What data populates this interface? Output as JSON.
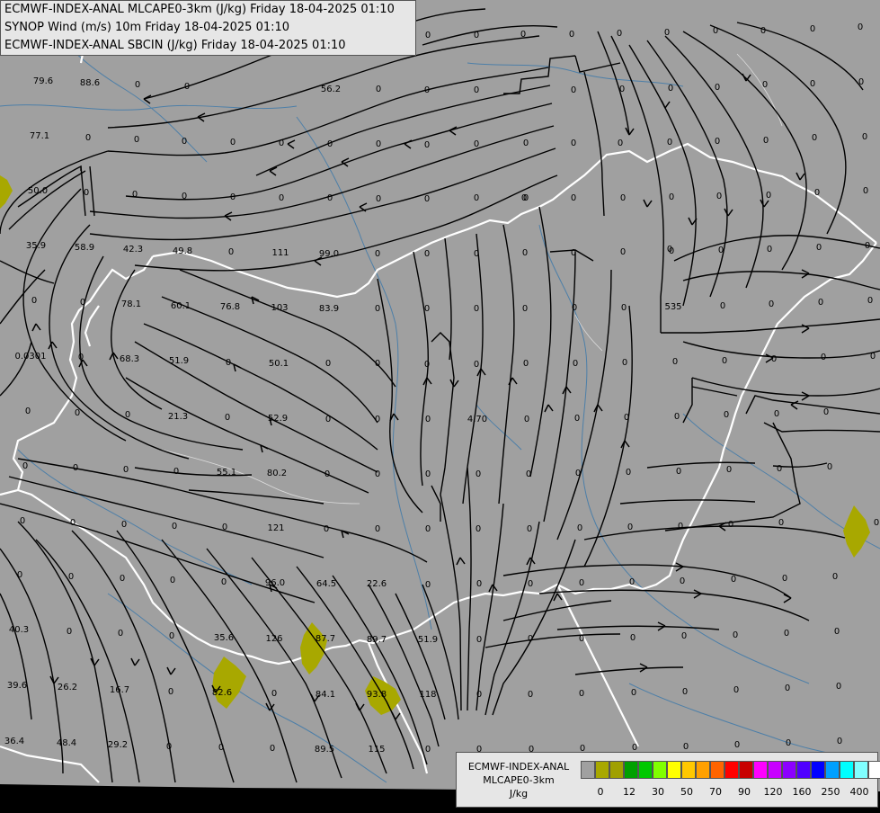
{
  "header": {
    "line1": "ECMWF-INDEX-ANAL MLCAPE0-3km (J/kg) Friday 18-04-2025 01:10",
    "line2": "SYNOP Wind (m/s) 10m Friday 18-04-2025 01:10",
    "line3": "ECMWF-INDEX-ANAL SBCIN (J/kg) Friday 18-04-2025 01:10"
  },
  "legend": {
    "title_line1": "ECMWF-INDEX-ANAL",
    "title_line2": "MLCAPE0-3km",
    "unit": "J/kg",
    "colors": [
      "#a0a0a0",
      "#a8a800",
      "#a0a000",
      "#00a000",
      "#00c800",
      "#80ff00",
      "#ffff00",
      "#ffc800",
      "#ffa000",
      "#ff6400",
      "#ff0000",
      "#c80000",
      "#ff00ff",
      "#c800ff",
      "#8c00ff",
      "#5000ff",
      "#0000ff",
      "#00a0ff",
      "#00ffff",
      "#80ffff",
      "#ffffff"
    ],
    "ticks": [
      "0",
      "12",
      "30",
      "50",
      "70",
      "90",
      "120",
      "160",
      "250",
      "400"
    ]
  },
  "colors": {
    "background": "#a0a0a0",
    "border": "#ffffff",
    "river": "#4d7fa8",
    "streamline": "#000000",
    "cape_fill": "#a8a800",
    "sea": "#000000"
  },
  "sbcin_labels": [
    [
      "x",
      48,
      89,
      "79.6"
    ],
    [
      "x",
      100,
      91,
      "88.6"
    ],
    [
      "x",
      153,
      93,
      "0"
    ],
    [
      "x",
      208,
      95,
      "0"
    ],
    [
      "x",
      368,
      98,
      "56.2"
    ],
    [
      "x",
      421,
      98,
      "0"
    ],
    [
      "x",
      475,
      99,
      "0"
    ],
    [
      "x",
      530,
      99,
      "0"
    ],
    [
      "x",
      44,
      150,
      "77.1"
    ],
    [
      "x",
      98,
      152,
      "0"
    ],
    [
      "x",
      152,
      154,
      "0"
    ],
    [
      "x",
      205,
      156,
      "0"
    ],
    [
      "x",
      259,
      157,
      "0"
    ],
    [
      "x",
      313,
      158,
      "0"
    ],
    [
      "x",
      367,
      159,
      "0"
    ],
    [
      "x",
      421,
      159,
      "0"
    ],
    [
      "x",
      475,
      160,
      "0"
    ],
    [
      "x",
      530,
      159,
      "0"
    ],
    [
      "x",
      585,
      158,
      "0"
    ],
    [
      "x",
      638,
      158,
      "0"
    ],
    [
      "x",
      42,
      211,
      "50.0"
    ],
    [
      "x",
      96,
      213,
      "0"
    ],
    [
      "x",
      150,
      215,
      "0"
    ],
    [
      "x",
      205,
      217,
      "0"
    ],
    [
      "x",
      259,
      218,
      "0"
    ],
    [
      "x",
      313,
      219,
      "0"
    ],
    [
      "x",
      367,
      219,
      "0"
    ],
    [
      "x",
      421,
      220,
      "0"
    ],
    [
      "x",
      475,
      220,
      "0"
    ],
    [
      "x",
      530,
      219,
      "0"
    ],
    [
      "x",
      585,
      219,
      "0"
    ],
    [
      "x",
      638,
      219,
      "0"
    ],
    [
      "x",
      693,
      219,
      "0"
    ],
    [
      "x",
      747,
      218,
      "0"
    ],
    [
      "x",
      800,
      217,
      "0"
    ],
    [
      "x",
      855,
      216,
      "0"
    ],
    [
      "x",
      40,
      272,
      "35.9"
    ],
    [
      "x",
      94,
      274,
      "58.9"
    ],
    [
      "x",
      148,
      276,
      "42.3"
    ],
    [
      "x",
      203,
      278,
      "49.8"
    ],
    [
      "x",
      257,
      279,
      "0"
    ],
    [
      "x",
      312,
      280,
      "111"
    ],
    [
      "x",
      366,
      281,
      "99.0"
    ],
    [
      "x",
      420,
      281,
      "0"
    ],
    [
      "x",
      475,
      281,
      "0"
    ],
    [
      "x",
      530,
      281,
      "0"
    ],
    [
      "x",
      584,
      280,
      "0"
    ],
    [
      "x",
      638,
      280,
      "0"
    ],
    [
      "x",
      693,
      279,
      "0"
    ],
    [
      "x",
      747,
      278,
      "0"
    ],
    [
      "x",
      802,
      277,
      "0"
    ],
    [
      "x",
      856,
      276,
      "0"
    ],
    [
      "x",
      911,
      274,
      "0"
    ],
    [
      "x",
      965,
      272,
      "0"
    ],
    [
      "x",
      38,
      333,
      "0"
    ],
    [
      "x",
      92,
      335,
      "0"
    ],
    [
      "x",
      146,
      337,
      "78.1"
    ],
    [
      "x",
      201,
      339,
      "60.1"
    ],
    [
      "x",
      256,
      340,
      "76.8"
    ],
    [
      "x",
      311,
      341,
      "103"
    ],
    [
      "x",
      366,
      342,
      "83.9"
    ],
    [
      "x",
      420,
      342,
      "0"
    ],
    [
      "x",
      475,
      342,
      "0"
    ],
    [
      "x",
      530,
      342,
      "0"
    ],
    [
      "x",
      584,
      342,
      "0"
    ],
    [
      "x",
      639,
      341,
      "0"
    ],
    [
      "x",
      694,
      341,
      "0"
    ],
    [
      "x",
      749,
      340,
      "535"
    ],
    [
      "x",
      804,
      339,
      "0"
    ],
    [
      "x",
      858,
      337,
      "0"
    ],
    [
      "x",
      913,
      335,
      "0"
    ],
    [
      "x",
      968,
      333,
      "0"
    ],
    [
      "x",
      34,
      395,
      "0.0301"
    ],
    [
      "x",
      90,
      396,
      "0"
    ],
    [
      "x",
      144,
      398,
      "68.3"
    ],
    [
      "x",
      199,
      400,
      "51.9"
    ],
    [
      "x",
      254,
      402,
      "0"
    ],
    [
      "x",
      310,
      403,
      "50.1"
    ],
    [
      "x",
      365,
      403,
      "0"
    ],
    [
      "x",
      420,
      403,
      "0"
    ],
    [
      "x",
      475,
      404,
      "0"
    ],
    [
      "x",
      530,
      404,
      "0"
    ],
    [
      "x",
      585,
      403,
      "0"
    ],
    [
      "x",
      640,
      403,
      "0"
    ],
    [
      "x",
      695,
      402,
      "0"
    ],
    [
      "x",
      751,
      401,
      "0"
    ],
    [
      "x",
      806,
      400,
      "0"
    ],
    [
      "x",
      861,
      398,
      "0"
    ],
    [
      "x",
      916,
      396,
      "0"
    ],
    [
      "x",
      971,
      395,
      "0"
    ],
    [
      "x",
      31,
      456,
      "0"
    ],
    [
      "x",
      86,
      458,
      "0"
    ],
    [
      "x",
      142,
      460,
      "0"
    ],
    [
      "x",
      198,
      462,
      "21.3"
    ],
    [
      "x",
      253,
      463,
      "0"
    ],
    [
      "x",
      309,
      464,
      "52.9"
    ],
    [
      "x",
      365,
      465,
      "0"
    ],
    [
      "x",
      420,
      465,
      "0"
    ],
    [
      "x",
      476,
      465,
      "0"
    ],
    [
      "x",
      531,
      465,
      "4.70"
    ],
    [
      "x",
      586,
      465,
      "0"
    ],
    [
      "x",
      642,
      464,
      "0"
    ],
    [
      "x",
      697,
      463,
      "0"
    ],
    [
      "x",
      753,
      462,
      "0"
    ],
    [
      "x",
      808,
      460,
      "0"
    ],
    [
      "x",
      864,
      459,
      "0"
    ],
    [
      "x",
      919,
      457,
      "0"
    ],
    [
      "x",
      28,
      517,
      "0"
    ],
    [
      "x",
      84,
      519,
      "0"
    ],
    [
      "x",
      140,
      521,
      "0"
    ],
    [
      "x",
      196,
      523,
      "0"
    ],
    [
      "x",
      252,
      524,
      "55.1"
    ],
    [
      "x",
      308,
      525,
      "80.2"
    ],
    [
      "x",
      364,
      526,
      "0"
    ],
    [
      "x",
      420,
      526,
      "0"
    ],
    [
      "x",
      476,
      526,
      "0"
    ],
    [
      "x",
      532,
      526,
      "0"
    ],
    [
      "x",
      588,
      526,
      "0"
    ],
    [
      "x",
      643,
      525,
      "0"
    ],
    [
      "x",
      699,
      524,
      "0"
    ],
    [
      "x",
      755,
      523,
      "0"
    ],
    [
      "x",
      811,
      521,
      "0"
    ],
    [
      "x",
      867,
      520,
      "0"
    ],
    [
      "x",
      923,
      518,
      "0"
    ],
    [
      "x",
      25,
      578,
      "0"
    ],
    [
      "x",
      81,
      580,
      "0"
    ],
    [
      "x",
      138,
      582,
      "0"
    ],
    [
      "x",
      194,
      584,
      "0"
    ],
    [
      "x",
      250,
      585,
      "0"
    ],
    [
      "x",
      307,
      586,
      "121"
    ],
    [
      "x",
      363,
      587,
      "0"
    ],
    [
      "x",
      420,
      587,
      "0"
    ],
    [
      "x",
      476,
      587,
      "0"
    ],
    [
      "x",
      532,
      587,
      "0"
    ],
    [
      "x",
      589,
      587,
      "0"
    ],
    [
      "x",
      645,
      586,
      "0"
    ],
    [
      "x",
      701,
      585,
      "0"
    ],
    [
      "x",
      757,
      584,
      "0"
    ],
    [
      "x",
      813,
      582,
      "0"
    ],
    [
      "x",
      869,
      580,
      "0"
    ],
    [
      "x",
      22,
      638,
      "0"
    ],
    [
      "x",
      79,
      640,
      "0"
    ],
    [
      "x",
      136,
      642,
      "0"
    ],
    [
      "x",
      192,
      644,
      "0"
    ],
    [
      "x",
      249,
      646,
      "0"
    ],
    [
      "x",
      306,
      647,
      "96.0"
    ],
    [
      "x",
      363,
      648,
      "64.5"
    ],
    [
      "x",
      419,
      648,
      "22.6"
    ],
    [
      "x",
      476,
      649,
      "0"
    ],
    [
      "x",
      533,
      648,
      "0"
    ],
    [
      "x",
      590,
      648,
      "0"
    ],
    [
      "x",
      647,
      647,
      "0"
    ],
    [
      "x",
      703,
      646,
      "0"
    ],
    [
      "x",
      759,
      645,
      "0"
    ],
    [
      "x",
      816,
      643,
      "0"
    ],
    [
      "x",
      873,
      642,
      "0"
    ],
    [
      "x",
      929,
      640,
      "0"
    ],
    [
      "x",
      21,
      699,
      "40.3"
    ],
    [
      "x",
      77,
      701,
      "0"
    ],
    [
      "x",
      134,
      703,
      "0"
    ],
    [
      "x",
      191,
      706,
      "0"
    ],
    [
      "x",
      249,
      708,
      "35.6"
    ],
    [
      "x",
      305,
      709,
      "126"
    ],
    [
      "x",
      362,
      709,
      "87.7"
    ],
    [
      "x",
      419,
      710,
      "89.7"
    ],
    [
      "x",
      476,
      710,
      "51.9"
    ],
    [
      "x",
      533,
      710,
      "0"
    ],
    [
      "x",
      590,
      709,
      "0"
    ],
    [
      "x",
      647,
      709,
      "0"
    ],
    [
      "x",
      704,
      708,
      "0"
    ],
    [
      "x",
      761,
      706,
      "0"
    ],
    [
      "x",
      818,
      705,
      "0"
    ],
    [
      "x",
      875,
      703,
      "0"
    ],
    [
      "x",
      931,
      701,
      "0"
    ],
    [
      "x",
      19,
      761,
      "39.6"
    ],
    [
      "x",
      75,
      763,
      "26.2"
    ],
    [
      "x",
      133,
      766,
      "16.7"
    ],
    [
      "x",
      190,
      768,
      "0"
    ],
    [
      "x",
      247,
      769,
      "82.6"
    ],
    [
      "x",
      305,
      770,
      "0"
    ],
    [
      "x",
      362,
      771,
      "84.1"
    ],
    [
      "x",
      419,
      771,
      "93.8"
    ],
    [
      "x",
      476,
      771,
      "118"
    ],
    [
      "x",
      533,
      771,
      "0"
    ],
    [
      "x",
      590,
      771,
      "0"
    ],
    [
      "x",
      647,
      770,
      "0"
    ],
    [
      "x",
      705,
      769,
      "0"
    ],
    [
      "x",
      762,
      768,
      "0"
    ],
    [
      "x",
      819,
      766,
      "0"
    ],
    [
      "x",
      876,
      764,
      "0"
    ],
    [
      "x",
      933,
      762,
      "0"
    ],
    [
      "x",
      16,
      823,
      "36.4"
    ],
    [
      "x",
      74,
      825,
      "48.4"
    ],
    [
      "x",
      131,
      827,
      "29.2"
    ],
    [
      "x",
      188,
      829,
      "0"
    ],
    [
      "x",
      246,
      830,
      "0"
    ],
    [
      "x",
      303,
      831,
      "0"
    ],
    [
      "x",
      361,
      832,
      "89.5"
    ],
    [
      "x",
      419,
      832,
      "115"
    ],
    [
      "x",
      476,
      832,
      "0"
    ],
    [
      "x",
      533,
      832,
      "0"
    ],
    [
      "x",
      591,
      832,
      "0"
    ],
    [
      "x",
      648,
      831,
      "0"
    ],
    [
      "x",
      706,
      830,
      "0"
    ],
    [
      "x",
      763,
      829,
      "0"
    ],
    [
      "x",
      820,
      827,
      "0"
    ],
    [
      "x",
      877,
      825,
      "0"
    ],
    [
      "x",
      934,
      823,
      "0"
    ],
    [
      "x",
      370,
      37,
      "0"
    ],
    [
      "x",
      424,
      37,
      "0"
    ],
    [
      "x",
      476,
      38,
      "0"
    ],
    [
      "x",
      530,
      38,
      "0"
    ],
    [
      "x",
      582,
      37,
      "0"
    ],
    [
      "x",
      636,
      37,
      "0"
    ],
    [
      "x",
      689,
      36,
      "0"
    ],
    [
      "x",
      742,
      35,
      "0"
    ],
    [
      "x",
      796,
      33,
      "0"
    ],
    [
      "x",
      849,
      33,
      "0"
    ],
    [
      "x",
      904,
      31,
      "0"
    ],
    [
      "x",
      957,
      29,
      "0"
    ],
    [
      "x",
      638,
      99,
      "0"
    ],
    [
      "x",
      692,
      98,
      "0"
    ],
    [
      "x",
      746,
      97,
      "0"
    ],
    [
      "x",
      798,
      96,
      "0"
    ],
    [
      "x",
      851,
      93,
      "0"
    ],
    [
      "x",
      904,
      92,
      "0"
    ],
    [
      "x",
      958,
      90,
      "0"
    ],
    [
      "x",
      690,
      158,
      "0"
    ],
    [
      "x",
      745,
      157,
      "0"
    ],
    [
      "x",
      798,
      156,
      "0"
    ],
    [
      "x",
      852,
      155,
      "0"
    ],
    [
      "x",
      906,
      152,
      "0"
    ],
    [
      "x",
      962,
      151,
      "0"
    ],
    [
      "x",
      909,
      213,
      "0"
    ],
    [
      "x",
      963,
      211,
      "0"
    ],
    [
      "x",
      583,
      219,
      "0"
    ],
    [
      "x",
      745,
      276,
      "0"
    ],
    [
      "x",
      975,
      580,
      "0"
    ]
  ]
}
